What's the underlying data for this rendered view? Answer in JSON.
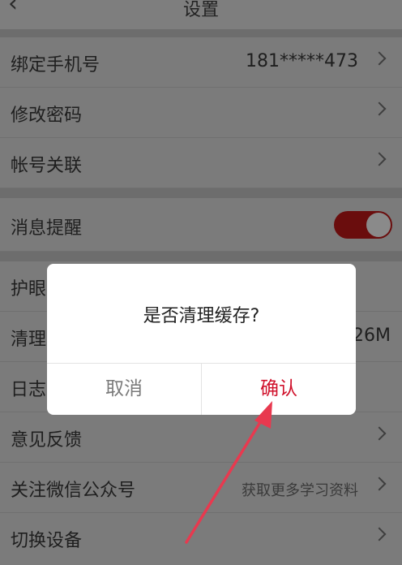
{
  "header": {
    "back_icon": "‹",
    "title": "设置"
  },
  "settings": {
    "phone": {
      "label": "绑定手机号",
      "value": "181*****473"
    },
    "password": {
      "label": "修改密码"
    },
    "account_link": {
      "label": "帐号关联"
    },
    "notification": {
      "label": "消息提醒",
      "enabled": true
    },
    "eye_protect": {
      "label": "护眼"
    },
    "clear_cache": {
      "label": "清理",
      "value": "26M"
    },
    "log": {
      "label": "日志"
    },
    "feedback": {
      "label": "意见反馈"
    },
    "wechat": {
      "label": "关注微信公众号",
      "value": "获取更多学习资料"
    },
    "switch_device": {
      "label": "切换设备"
    }
  },
  "dialog": {
    "message": "是否清理缓存?",
    "cancel": "取消",
    "confirm": "确认"
  },
  "colors": {
    "toggle_on": "#6a0d0d",
    "confirm": "#d0112b",
    "arrow": "#e8394f"
  }
}
